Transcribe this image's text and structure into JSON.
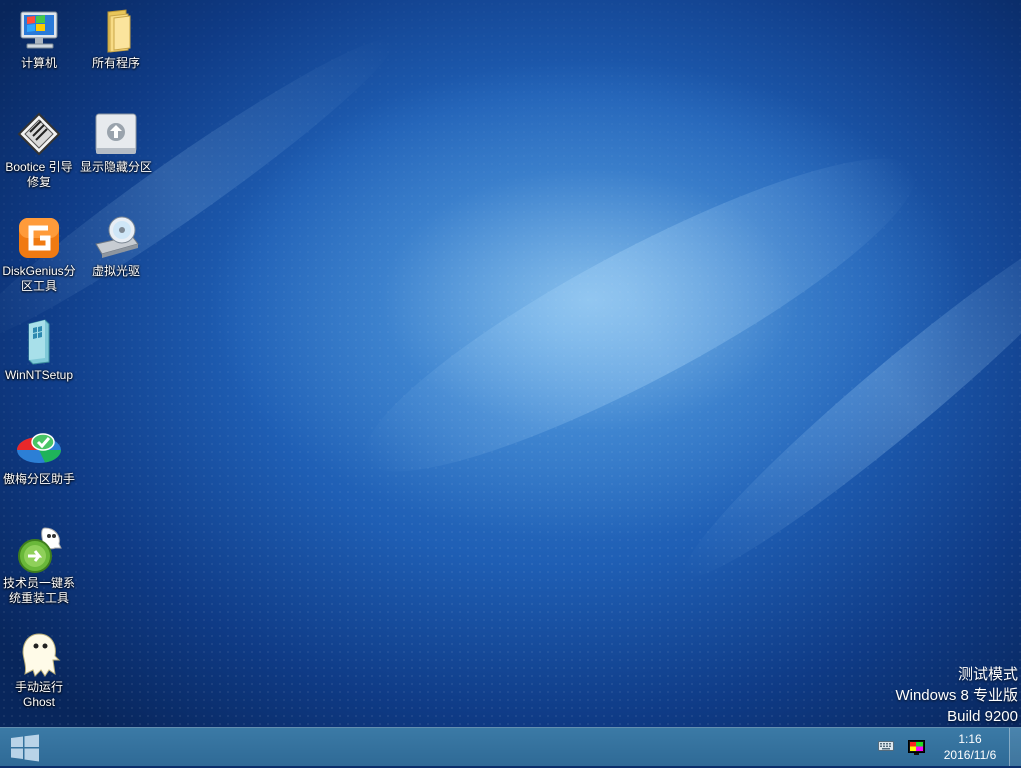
{
  "desktop_icons": [
    {
      "id": "computer",
      "label": "计算机"
    },
    {
      "id": "all-programs",
      "label": "所有程序"
    },
    {
      "id": "bootice",
      "label": "Bootice 引导修复"
    },
    {
      "id": "show-hidden-partition",
      "label": "显示隐藏分区"
    },
    {
      "id": "diskgenius",
      "label": "DiskGenius分区工具"
    },
    {
      "id": "virtual-drive",
      "label": "虚拟光驱"
    },
    {
      "id": "winntsetup",
      "label": "WinNTSetup"
    },
    {
      "id": "aomei",
      "label": "傲梅分区助手"
    },
    {
      "id": "reinstall",
      "label": "技术员一键系统重装工具"
    },
    {
      "id": "ghost",
      "label": "手动运行Ghost"
    }
  ],
  "watermark": {
    "line1": "测试模式",
    "line2": "Windows 8 专业版",
    "line3": "Build 9200"
  },
  "taskbar": {
    "time": "1:16",
    "date": "2016/11/6",
    "start_icon": "windows-logo-icon",
    "tray_icons": [
      "keyboard-icon",
      "color-display-icon"
    ]
  },
  "colors": {
    "taskbar": "#3572a0",
    "desktop_dark": "#0b2f6b",
    "desktop_light": "#8cc4f0"
  }
}
